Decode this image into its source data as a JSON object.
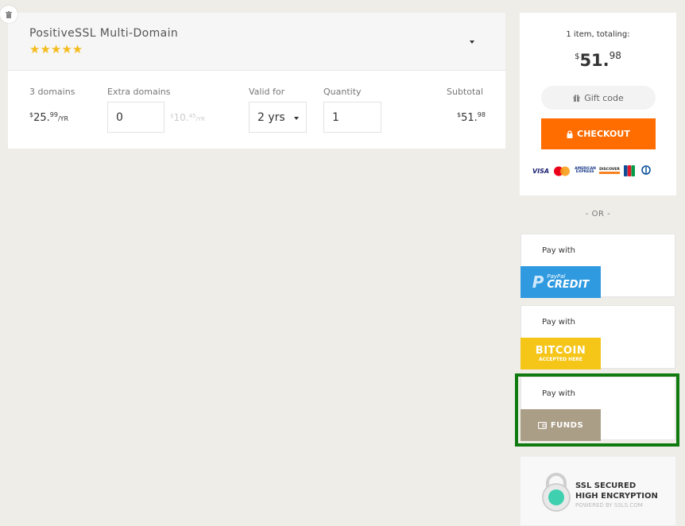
{
  "product": {
    "title": "PositiveSSL Multi-Domain",
    "stars": "★★★★★",
    "rating": 5,
    "columns": {
      "domains_label": "3 domains",
      "extra_label": "Extra domains",
      "valid_label": "Valid for",
      "quantity_label": "Quantity",
      "subtotal_label": "Subtotal"
    },
    "domain_price": {
      "currency": "$",
      "whole": "25.",
      "cents": "99",
      "unit": "/YR"
    },
    "extra_domains_value": "0",
    "extra_price": {
      "currency": "$",
      "whole": "10.",
      "cents": "45",
      "unit": "/YR"
    },
    "valid_for_value": "2 yrs",
    "quantity_value": "1",
    "subtotal": {
      "currency": "$",
      "whole": "51.",
      "cents": "98"
    }
  },
  "summary": {
    "items_total_text": "1 item, totaling:",
    "total": {
      "currency": "$",
      "whole": "51.",
      "cents": "98"
    },
    "gift_label": "Gift code",
    "checkout_label": "CHECKOUT",
    "card_logos": [
      "VISA",
      "mastercard",
      "AMERICAN EXPRESS",
      "DISCOVER",
      "JCB",
      "Diners Club"
    ]
  },
  "or_text": "- OR -",
  "pay_options": [
    {
      "label": "Pay with",
      "badge_small": "PayPal",
      "badge_big": "CREDIT"
    },
    {
      "label": "Pay with",
      "badge_big": "BITCOIN",
      "badge_small": "ACCEPTED HERE"
    },
    {
      "label": "Pay with",
      "badge_big": "FUNDS"
    }
  ],
  "ssl_seal": {
    "line1": "SSL SECURED",
    "line2": "HIGH ENCRYPTION",
    "line3": "POWERED BY SSLS.COM"
  },
  "colors": {
    "checkout": "#ff6c00",
    "stars": "#f4bb1c",
    "paypal": "#2f9ae0",
    "bitcoin": "#f5c518",
    "funds": "#ab9e87",
    "highlight": "#0f7a0f"
  }
}
